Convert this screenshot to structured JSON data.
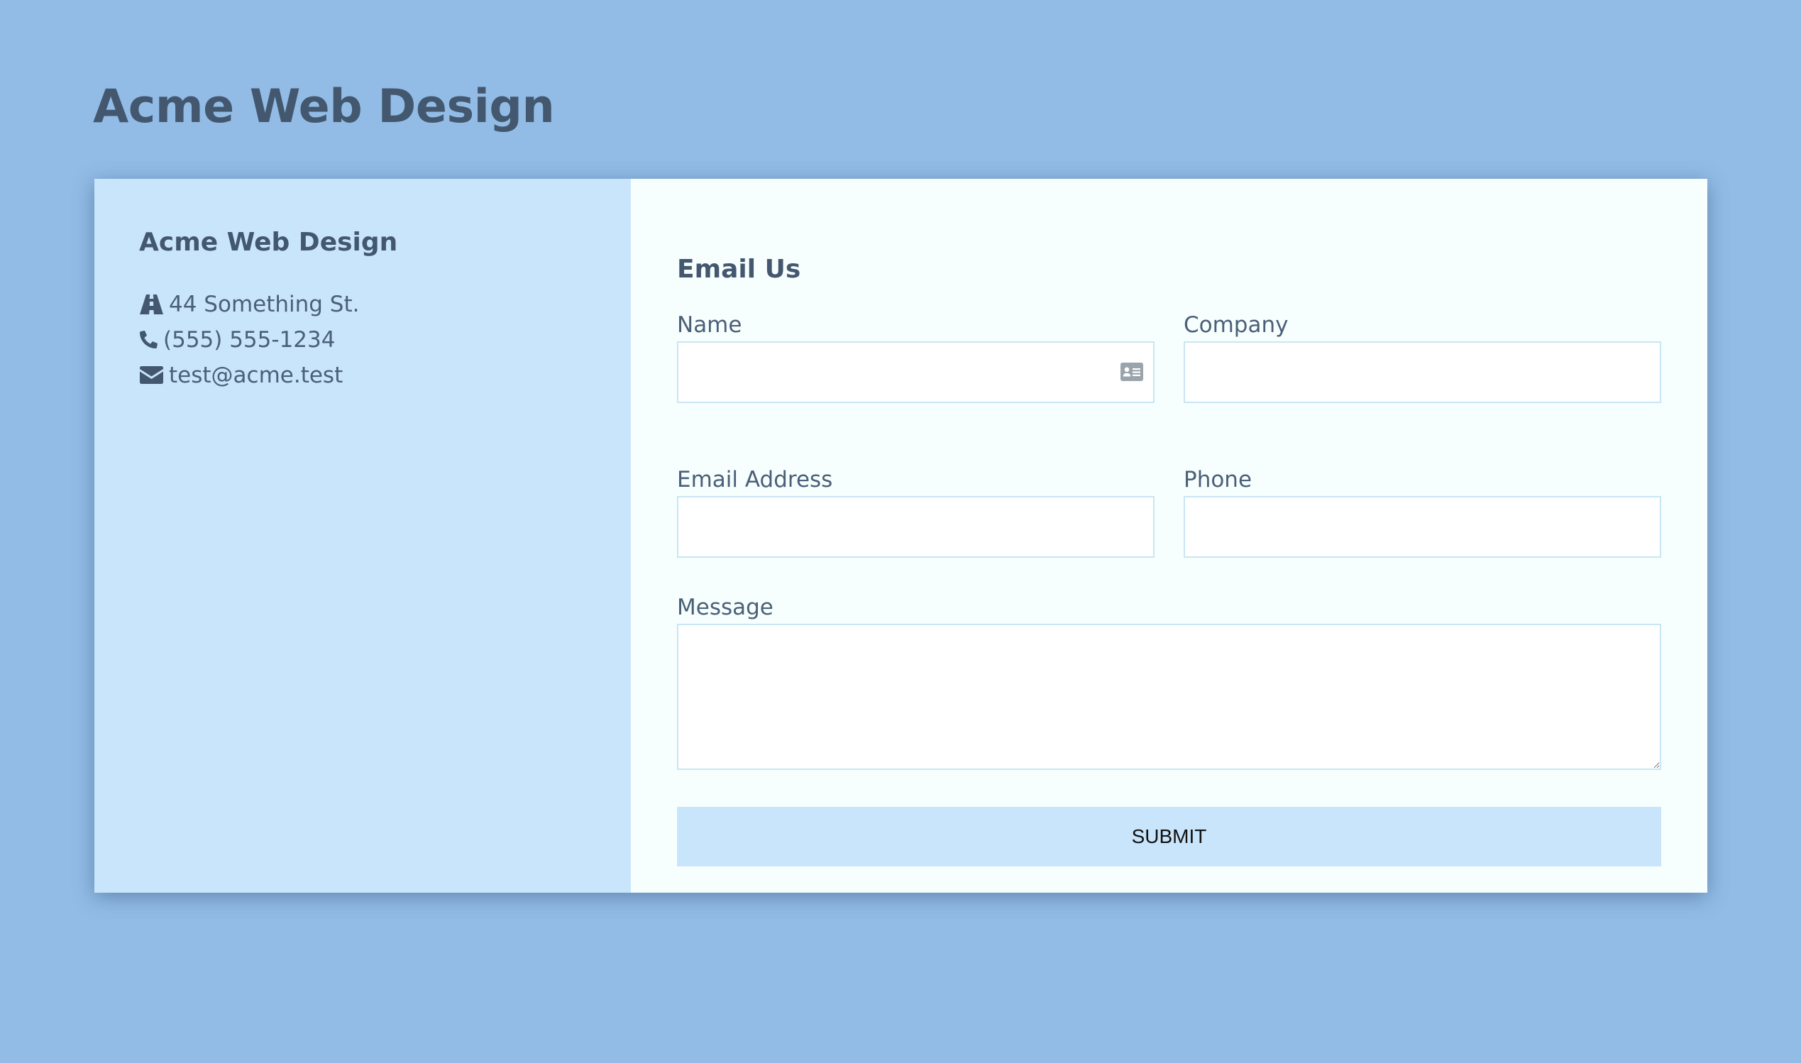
{
  "header": {
    "title": "Acme Web Design"
  },
  "contact": {
    "title": "Acme Web Design",
    "items": [
      {
        "icon": "road-icon",
        "text": "44 Something St."
      },
      {
        "icon": "phone-icon",
        "text": "(555) 555-1234"
      },
      {
        "icon": "envelope-icon",
        "text": "test@acme.test"
      }
    ]
  },
  "form": {
    "title": "Email Us",
    "fields": {
      "name": {
        "label": "Name",
        "value": "",
        "placeholder": ""
      },
      "company": {
        "label": "Company",
        "value": "",
        "placeholder": ""
      },
      "email": {
        "label": "Email Address",
        "value": "",
        "placeholder": ""
      },
      "phone": {
        "label": "Phone",
        "value": "",
        "placeholder": ""
      },
      "message": {
        "label": "Message",
        "value": "",
        "placeholder": ""
      }
    },
    "submit_label": "SUBMIT"
  },
  "colors": {
    "page_background": "#92bce6",
    "info_panel": "#c9e5fb",
    "form_panel": "#f7fefe",
    "text": "#43586f",
    "input_border": "#c8e6f5",
    "submit_background": "#c9e5fb"
  }
}
